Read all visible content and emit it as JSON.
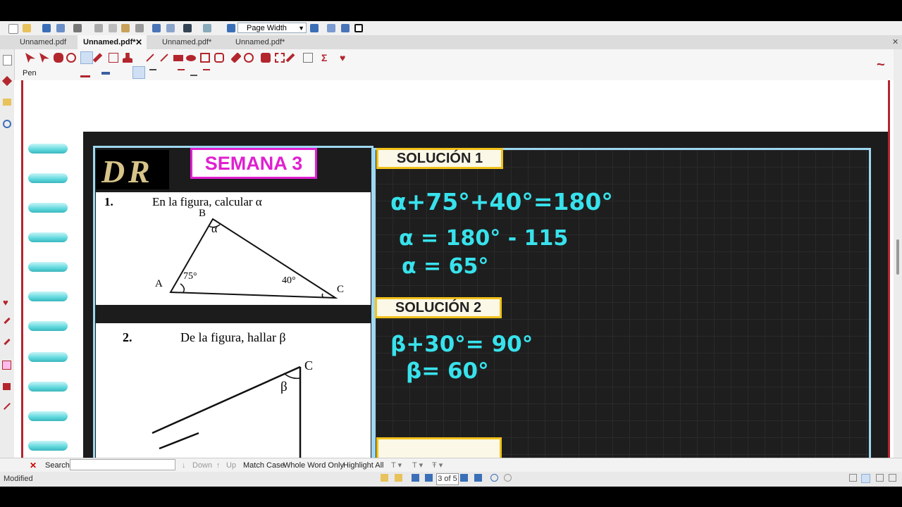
{
  "toolbar": {
    "zoom_value": "Page Width",
    "tool_label": "Pen"
  },
  "tabs": [
    {
      "label": "Unnamed.pdf"
    },
    {
      "label": "Unnamed.pdf*"
    },
    {
      "label": "Unnamed.pdf*"
    },
    {
      "label": "Unnamed.pdf*"
    }
  ],
  "document": {
    "badge": "SEMANA 3",
    "problem1": {
      "number": "1.",
      "text": "En la figura, calcular α",
      "vertex_b": "B",
      "vertex_a": "A",
      "vertex_c": "C",
      "angle_alpha": "α",
      "angle_a": "75°",
      "angle_c": "40°"
    },
    "problem2": {
      "number": "2.",
      "text": "De la figura, hallar β",
      "vertex_c": "C",
      "angle_beta": "β"
    },
    "solution1": {
      "title": "SOLUCIÓN 1",
      "line1": "α+75°+40°=180°",
      "line2": "α = 180° - 115",
      "line3": "α = 65°"
    },
    "solution2": {
      "title": "SOLUCIÓN 2",
      "line1": "β+30°= 90°",
      "line2": "β= 60°"
    }
  },
  "search": {
    "label": "Search:",
    "value": "",
    "down": "Down",
    "up": "Up",
    "match_case": "Match Case",
    "whole_word": "Whole Word Only",
    "highlight_all": "Highlight All"
  },
  "status": {
    "state": "Modified",
    "page_indicator": "3 of 5"
  },
  "colors": {
    "accent_cyan": "#38e2ec",
    "solution_border": "#f2c21b",
    "badge_magenta": "#e020d0"
  }
}
